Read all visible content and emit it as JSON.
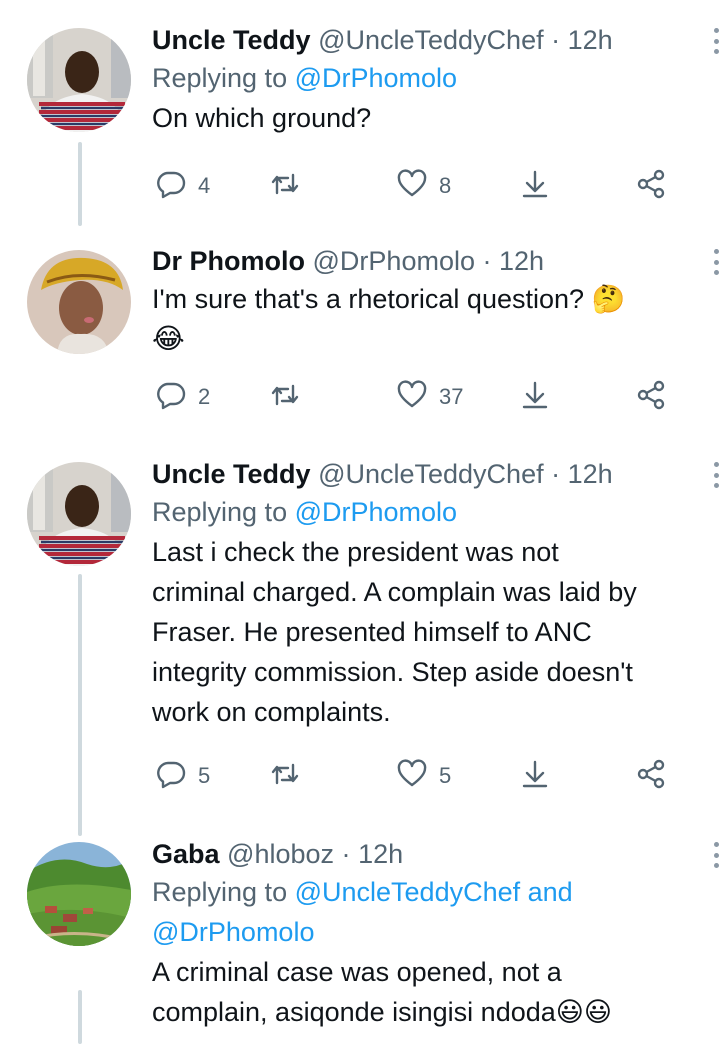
{
  "tweets": [
    {
      "name": "Uncle Teddy",
      "handle": "@UncleTeddyChef",
      "time": "12h",
      "replying_label": "Replying to ",
      "replying_to": "@DrPhomolo",
      "replying_and": "",
      "replying_to2": "",
      "text_lines": [
        "On which ground?"
      ],
      "replies": "4",
      "retweets": "",
      "likes": "8",
      "avatar": "uncle-teddy"
    },
    {
      "name": "Dr Phomolo",
      "handle": "@DrPhomolo",
      "time": "12h",
      "text_lines": [
        "I'm sure that's a rhetorical question? 🤔",
        "😂"
      ],
      "replies": "2",
      "retweets": "",
      "likes": "37",
      "avatar": "dr-phomolo"
    },
    {
      "name": "Uncle Teddy",
      "handle": "@UncleTeddyChef",
      "time": "12h",
      "replying_label": "Replying to ",
      "replying_to": "@DrPhomolo",
      "text_lines": [
        "Last i check the president was not",
        "criminal charged. A complain was laid by",
        "Fraser. He presented himself to ANC",
        "integrity commission. Step aside doesn't",
        "work on complaints."
      ],
      "replies": "5",
      "retweets": "",
      "likes": "5",
      "avatar": "uncle-teddy"
    },
    {
      "name": "Gaba",
      "handle": "@hloboz",
      "time": "12h",
      "replying_label": "Replying to ",
      "replying_to": "@UncleTeddyChef",
      "replying_and": " and",
      "replying_to2": "@DrPhomolo",
      "text_lines": [
        "A criminal case was opened, not a",
        "complain, asiqonde isingisi ndoda😃😃"
      ],
      "avatar": "landscape"
    }
  ],
  "separator": "·",
  "colors": {
    "accent": "#1d9bf0",
    "secondary_text": "#536471",
    "thread_line": "#cfd9de"
  },
  "icons": [
    "reply-icon",
    "retweet-icon",
    "like-icon",
    "share-icon",
    "send-icon",
    "more-icon"
  ]
}
